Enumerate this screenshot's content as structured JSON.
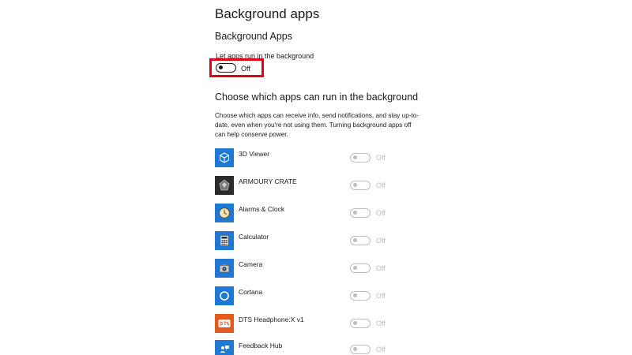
{
  "page": {
    "title": "Background apps",
    "section_heading": "Background Apps",
    "master_toggle": {
      "label": "Let apps run in the background",
      "state": "Off"
    },
    "choose_heading": "Choose which apps can run in the background",
    "choose_description": "Choose which apps can receive info, send notifications, and stay up-to-date, even when you're not using them. Turning background apps off can help conserve power."
  },
  "apps": [
    {
      "name": "3D Viewer",
      "icon": "cube-icon",
      "state": "Off"
    },
    {
      "name": "ARMOURY CRATE",
      "icon": "armoury-crate-icon",
      "state": "Off"
    },
    {
      "name": "Alarms & Clock",
      "icon": "clock-icon",
      "state": "Off"
    },
    {
      "name": "Calculator",
      "icon": "calculator-icon",
      "state": "Off"
    },
    {
      "name": "Camera",
      "icon": "camera-icon",
      "state": "Off"
    },
    {
      "name": "Cortana",
      "icon": "cortana-icon",
      "state": "Off"
    },
    {
      "name": "DTS Headphone:X v1",
      "icon": "dts-icon",
      "state": "Off"
    },
    {
      "name": "Feedback Hub",
      "icon": "feedback-hub-icon",
      "state": "Off"
    }
  ],
  "colors": {
    "highlight": "#e0001b",
    "app_tile_blue": "#1e78d4",
    "app_tile_dark": "#2b2b2b",
    "app_tile_orange": "#e55a1c",
    "toggle_disabled": "#bdbdbd"
  }
}
